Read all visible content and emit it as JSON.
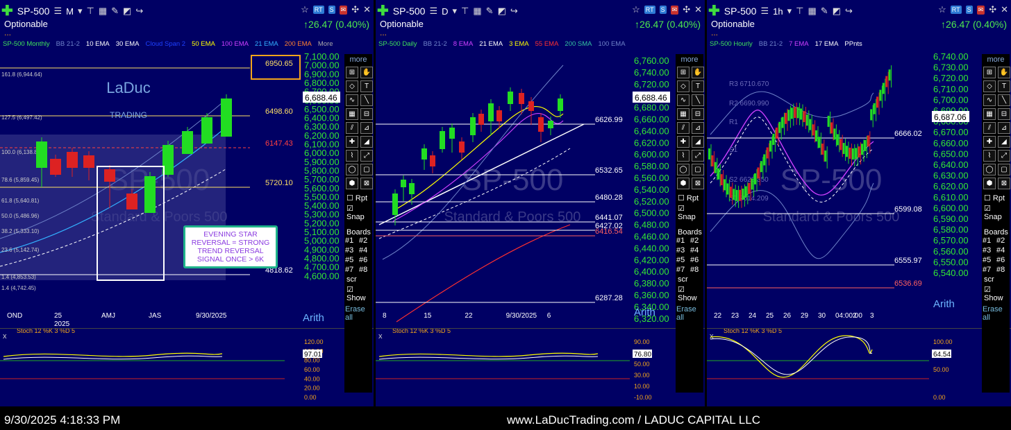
{
  "colors": {
    "bg": "#000064",
    "up": "#22dd22",
    "down": "#dd2222",
    "price": "#33e833",
    "accent": "#f3a51b"
  },
  "panels": [
    {
      "symbol": "SP-500",
      "timeframe": "M",
      "subtitle": "Optionable",
      "change": "↑26.47 (0.40%)",
      "legend": [
        [
          "SP-500 Monthly",
          "#3fe05b"
        ],
        [
          "BB 21-2",
          "#6e82c8"
        ],
        [
          "10 EMA",
          "#ffffff"
        ],
        [
          "30 EMA",
          "#ffffff"
        ],
        [
          "Cloud Span 2",
          "#1e40ff"
        ],
        [
          "50 EMA",
          "#ffff00"
        ],
        [
          "100 EMA",
          "#d040ff"
        ],
        [
          "21 EMA",
          "#33b0ff"
        ],
        [
          "200 EMA",
          "#ff8030"
        ],
        [
          "More",
          "#aaaaaa"
        ]
      ],
      "yticks": [
        "7,100.00",
        "7,000.00",
        "6,900.00",
        "6,800.00",
        "6,700.00",
        "6,600.00",
        "6,500.00",
        "6,400.00",
        "6,300.00",
        "6,200.00",
        "6,100.00",
        "6,000.00",
        "5,900.00",
        "5,800.00",
        "5,700.00",
        "5,600.00",
        "5,500.00",
        "5,400.00",
        "5,300.00",
        "5,200.00",
        "5,100.00",
        "5,000.00",
        "4,900.00",
        "4,800.00",
        "4,700.00",
        "4,600.00"
      ],
      "last_price": "6,688.46",
      "xticks": [
        "OND",
        "25\n2025",
        "AMJ",
        "JAS",
        "9/30/2025"
      ],
      "levels": [
        [
          "6950.65",
          "#ffe066"
        ],
        [
          "6498.60",
          "#ffe066"
        ],
        [
          "6147.43",
          "#ff4040"
        ],
        [
          "5720.10",
          "#ffe066"
        ],
        [
          "4818.62",
          "#ffffff"
        ]
      ],
      "fib": [
        "161.8 (6,944.64)",
        "127.5 (6,497.42)",
        "100.0 (6,138.87)",
        "78.6 (5,859.45)",
        "61.8 (5,640.81)",
        "50.0 (5,486.96)",
        "38.2 (5,333.10)",
        "23.6 (5,142.74)",
        "1.4 (4,853.53)",
        "1.4 (4,742.45)"
      ],
      "logo_top": "LaDuc",
      "logo_bottom": "TRADING",
      "watermark": "SP-500",
      "watermark2": "Standard & Poors 500",
      "callout": "EVENING STAR REVERSAL = STRONG TREND REVERSAL SIGNAL ONCE > 6K",
      "stoch_label": "Stoch 12 %K 3  %D 5",
      "stoch_ticks": [
        "120.00",
        "100.00",
        "80.00",
        "60.00",
        "40.00",
        "20.00",
        "0.00"
      ],
      "stoch_value": "97.01"
    },
    {
      "symbol": "SP-500",
      "timeframe": "D",
      "subtitle": "Optionable",
      "change": "↑26.47 (0.40%)",
      "legend": [
        [
          "SP-500 Daily",
          "#3fe05b"
        ],
        [
          "BB 21-2",
          "#6e82c8"
        ],
        [
          "8 EMA",
          "#d040ff"
        ],
        [
          "21 EMA",
          "#ffffff"
        ],
        [
          "3 EMA",
          "#ffff00"
        ],
        [
          "55 EMA",
          "#ff3030"
        ],
        [
          "200 SMA",
          "#33c0a0"
        ],
        [
          "100 EMA",
          "#6e82c8"
        ]
      ],
      "yticks": [
        "6,760.00",
        "6,740.00",
        "6,720.00",
        "6,700.00",
        "6,680.00",
        "6,660.00",
        "6,640.00",
        "6,620.00",
        "6,600.00",
        "6,580.00",
        "6,560.00",
        "6,540.00",
        "6,520.00",
        "6,500.00",
        "6,480.00",
        "6,460.00",
        "6,440.00",
        "6,420.00",
        "6,400.00",
        "6,380.00",
        "6,360.00",
        "6,340.00",
        "6,320.00"
      ],
      "last_price": "6,688.46",
      "xticks": [
        "8",
        "15",
        "22",
        "9/30/2025",
        "6"
      ],
      "levels": [
        [
          "6626.99",
          "#ffffff"
        ],
        [
          "6532.65",
          "#ffffff"
        ],
        [
          "6480.28",
          "#ffffff"
        ],
        [
          "6441.07",
          "#ffffff"
        ],
        [
          "6427.02",
          "#ffffff"
        ],
        [
          "6416.54",
          "#ff6060"
        ],
        [
          "6287.28",
          "#ffffff"
        ]
      ],
      "watermark": "SP-500",
      "watermark2": "Standard & Poors 500",
      "stoch_label": "Stoch 12 %K 3  %D 5",
      "stoch_ticks": [
        "90.00",
        "70.00",
        "50.00",
        "30.00",
        "10.00",
        "-10.00"
      ],
      "stoch_value": "76.80"
    },
    {
      "symbol": "SP-500",
      "timeframe": "1h",
      "subtitle": "Optionable",
      "change": "↑26.47 (0.40%)",
      "legend": [
        [
          "SP-500 Hourly",
          "#3fe05b"
        ],
        [
          "BB 21-2",
          "#6e82c8"
        ],
        [
          "7 EMA",
          "#d040ff"
        ],
        [
          "17 EMA",
          "#ffffff"
        ],
        [
          "PPnts",
          "#ffffff"
        ]
      ],
      "yticks": [
        "6,740.00",
        "6,730.00",
        "6,720.00",
        "6,710.00",
        "6,700.00",
        "6,690.00",
        "6,680.00",
        "6,670.00",
        "6,660.00",
        "6,650.00",
        "6,640.00",
        "6,630.00",
        "6,620.00",
        "6,610.00",
        "6,600.00",
        "6,590.00",
        "6,580.00",
        "6,570.00",
        "6,560.00",
        "6,550.00",
        "6,540.00"
      ],
      "last_price": "6,687.06",
      "xticks": [
        "22",
        "23",
        "24",
        "25",
        "26",
        "29",
        "30",
        "04:00:00",
        "2",
        "3"
      ],
      "levels": [
        [
          "6666.02",
          "#ffffff"
        ],
        [
          "6599.08",
          "#ffffff"
        ],
        [
          "6555.97",
          "#ffffff"
        ],
        [
          "6536.69",
          "#ff6060"
        ]
      ],
      "pivots": [
        "R3 6710.670",
        "R2 6690.990",
        "R1",
        "S1",
        "S2 6628.350",
        "S3 6614.209"
      ],
      "watermark": "SP-500",
      "watermark2": "Standard & Poors 500",
      "stoch_label": "Stoch 12 %K 3  %D 5",
      "stoch_ticks": [
        "100.00",
        "50.00",
        "0.00"
      ],
      "stoch_value": "64.54"
    }
  ],
  "sidebar": {
    "more": "more",
    "rpt": "Rpt",
    "snap": "Snap",
    "boards": "Boards",
    "board_items": [
      "#1",
      "#2",
      "#3",
      "#4",
      "#5",
      "#6",
      "#7",
      "#8"
    ],
    "scr": "scr",
    "show": "Show",
    "erase": "Erase all"
  },
  "arith": "Arith",
  "footer": {
    "timestamp": "9/30/2025 4:18:33 PM",
    "site": "www.LaDucTrading.com / LADUC CAPITAL LLC"
  }
}
